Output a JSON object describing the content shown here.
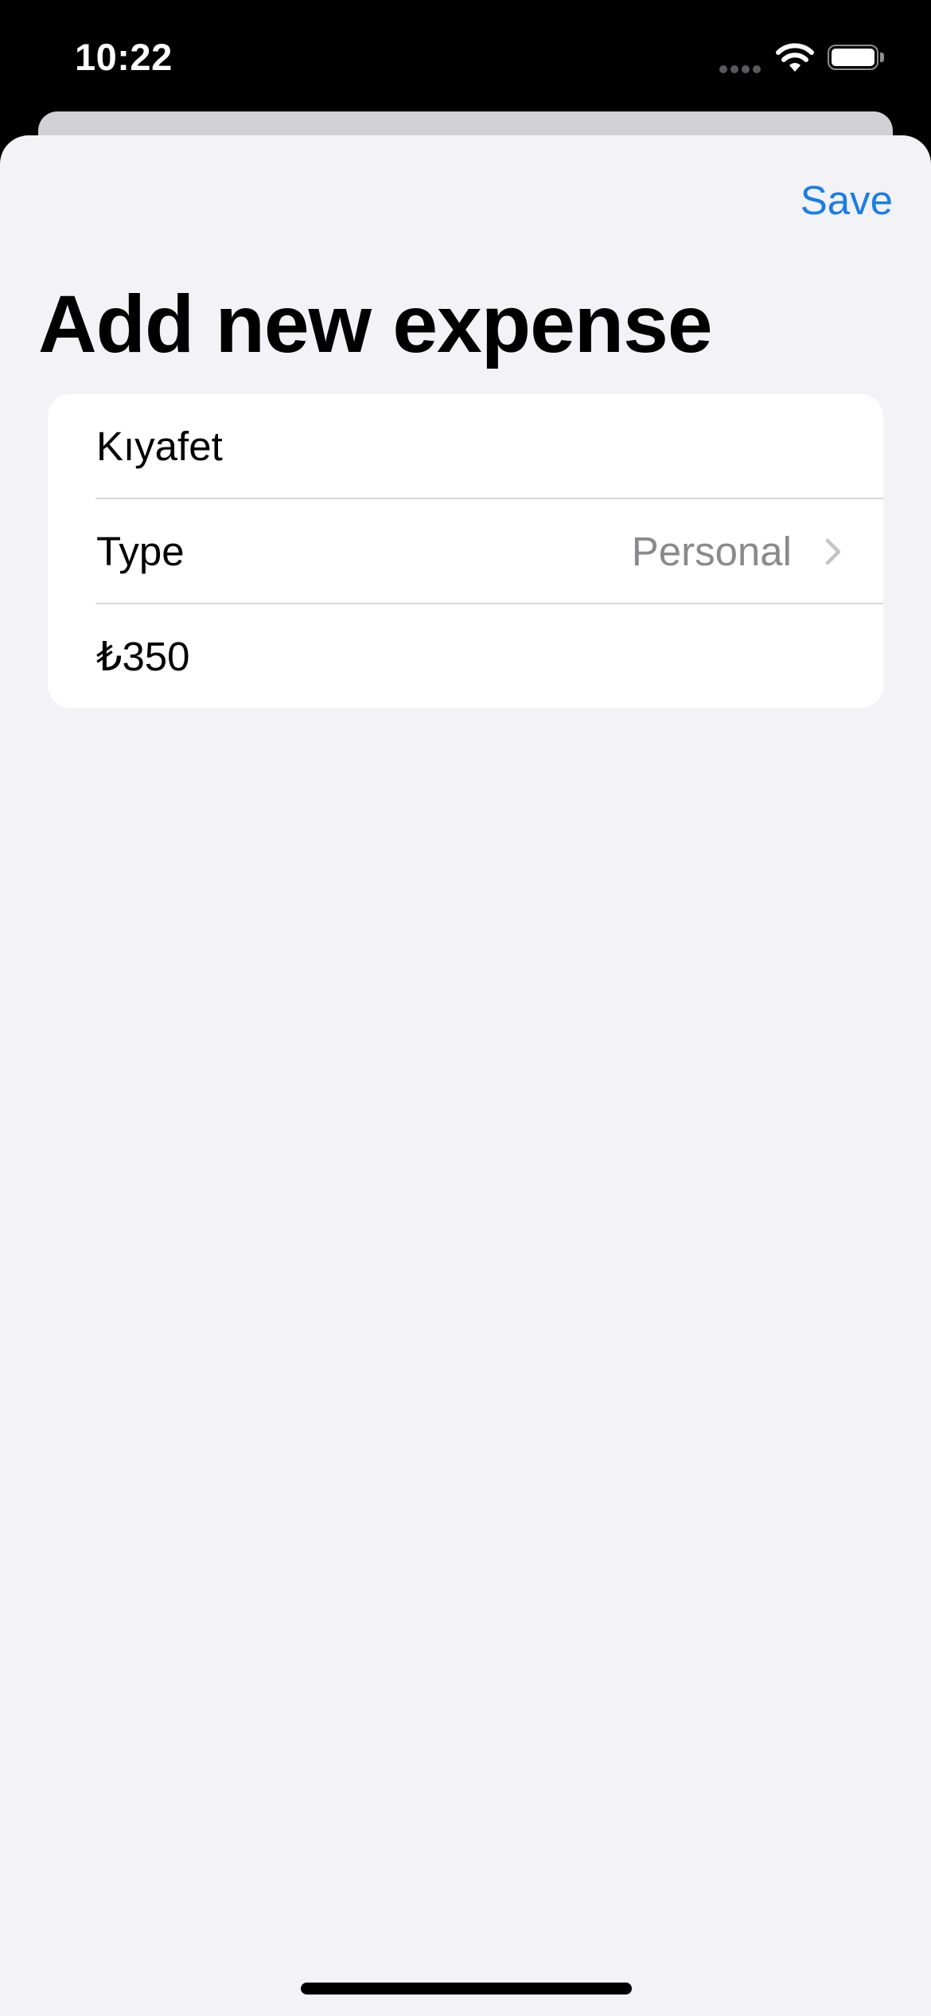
{
  "status_bar": {
    "time": "10:22",
    "signal_icon": "cellular-signal-icon",
    "wifi_icon": "wifi-icon",
    "battery_icon": "battery-full-icon"
  },
  "nav": {
    "save_label": "Save"
  },
  "title": "Add new expense",
  "form": {
    "name_value": "Kıyafet",
    "type_label": "Type",
    "type_value": "Personal",
    "type_chevron_icon": "chevron-right-icon",
    "amount_value": "₺350"
  },
  "colors": {
    "accent": "#1a7ee6",
    "background": "#f2f2f7",
    "card": "#ffffff",
    "secondary_text": "#8a8a8e"
  }
}
